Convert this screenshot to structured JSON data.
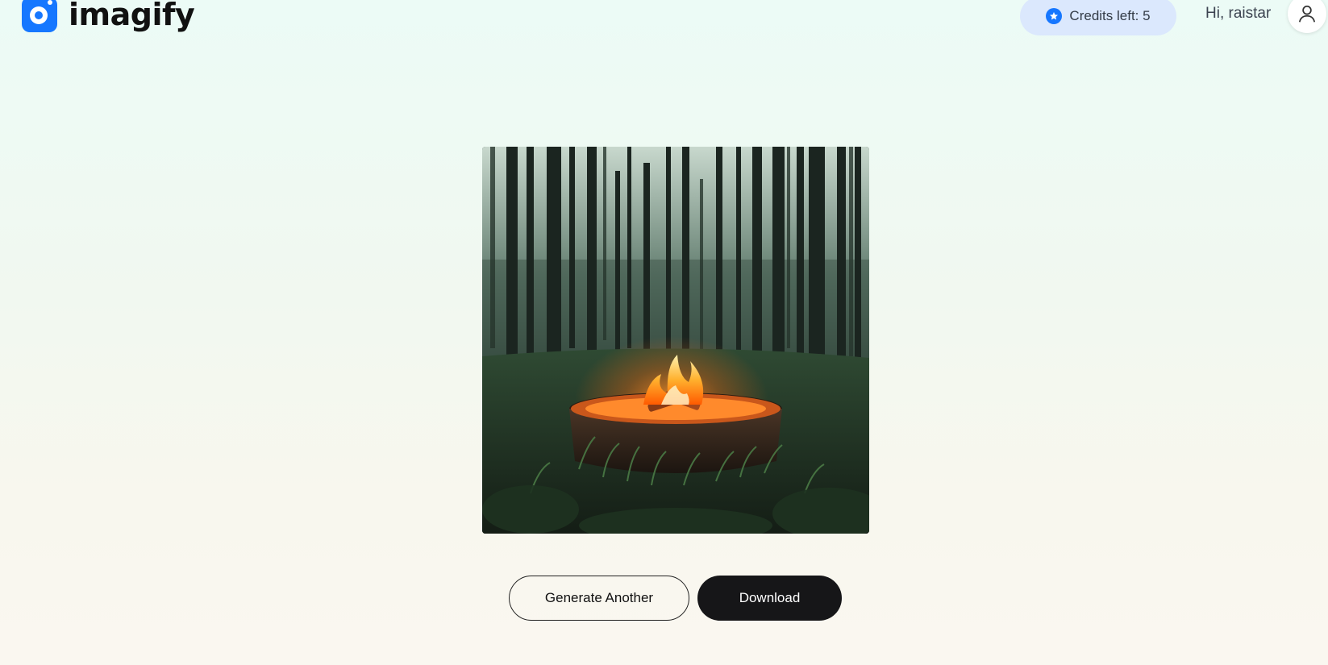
{
  "header": {
    "logo_text": "imagify",
    "credits_label": "Credits left: 5",
    "greeting": "Hi, raistar",
    "accent_color": "#1677ff"
  },
  "icons": {
    "logo": "camera-lens-logo-icon",
    "credits": "star-badge-icon",
    "avatar": "user-profile-icon"
  },
  "main": {
    "image_description_icon": "generated-image",
    "buttons": {
      "generate_another": "Generate Another",
      "download": "Download"
    }
  }
}
